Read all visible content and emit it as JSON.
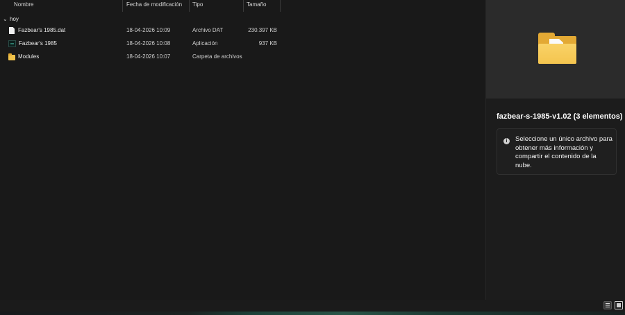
{
  "columns": {
    "name": "Nombre",
    "date": "Fecha de modificación",
    "type": "Tipo",
    "size": "Tamaño"
  },
  "group": {
    "label": "hoy"
  },
  "files": [
    {
      "name": "Fazbear's 1985.dat",
      "date": "18-04-2026 10:09",
      "type": "Archivo DAT",
      "size": "230.397 KB",
      "icon": "document-icon"
    },
    {
      "name": "Fazbear's 1985",
      "date": "18-04-2026 10:08",
      "type": "Aplicación",
      "size": "937 KB",
      "icon": "application-icon"
    },
    {
      "name": "Modules",
      "date": "18-04-2026 10:07",
      "type": "Carpeta de archivos",
      "size": "",
      "icon": "folder-icon"
    }
  ],
  "details": {
    "title": "fazbear-s-1985-v1.02 (3 elementos)",
    "info": "Seleccione un único archivo para obtener más información y compartir el contenido de la nube."
  },
  "colors": {
    "background": "#191919",
    "pane": "#1c1c1c",
    "preview": "#2b2b2b",
    "folder": "#f4c54f"
  }
}
